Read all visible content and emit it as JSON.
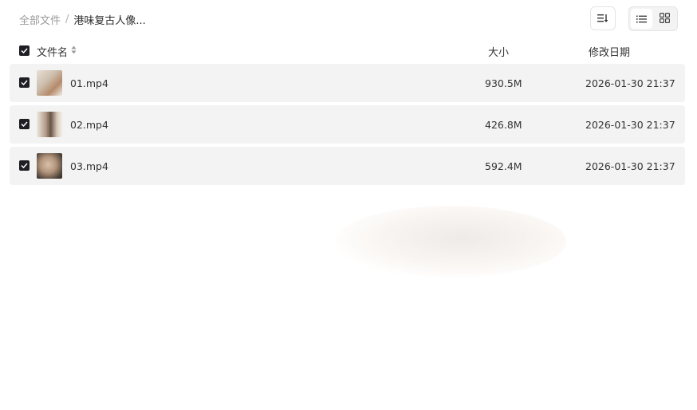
{
  "breadcrumb": {
    "root": "全部文件",
    "separator": "/",
    "current": "港味复古人像..."
  },
  "toolbar": {
    "sort_icon": "sort-icon",
    "view_list_icon": "list-view-icon",
    "view_grid_icon": "grid-view-icon",
    "active_view": "list"
  },
  "table": {
    "columns": {
      "name": "文件名",
      "size": "大小",
      "date": "修改日期"
    },
    "rows": [
      {
        "name": "01.mp4",
        "size": "930.5M",
        "date": "2026-01-30 21:37",
        "checked": true
      },
      {
        "name": "02.mp4",
        "size": "426.8M",
        "date": "2026-01-30 21:37",
        "checked": true
      },
      {
        "name": "03.mp4",
        "size": "592.4M",
        "date": "2026-01-30 21:37",
        "checked": true
      }
    ]
  },
  "colors": {
    "checkbox": "#1f1f23",
    "row_bg": "#f3f3f3",
    "muted_text": "#9a9a9a"
  }
}
